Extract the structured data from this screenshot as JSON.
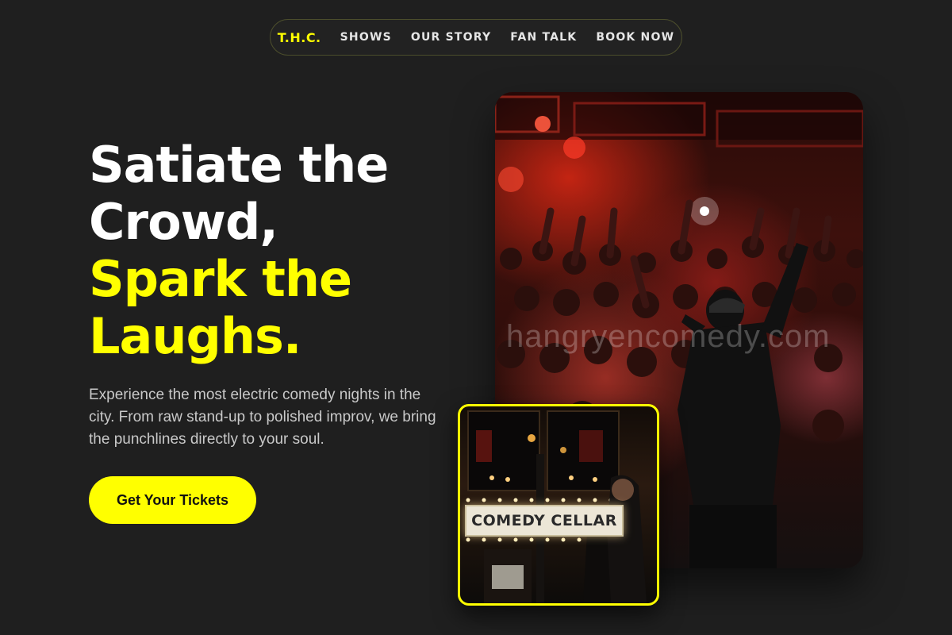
{
  "nav": {
    "brand": "T.H.C.",
    "links": [
      "SHOWS",
      "OUR STORY",
      "FAN TALK",
      "BOOK NOW"
    ]
  },
  "hero": {
    "title_lines_white": [
      "Satiate the",
      "Crowd,"
    ],
    "title_lines_yellow": [
      "Spark the",
      "Laughs."
    ],
    "description": "Experience the most electric comedy nights in the city. From raw stand-up to polished improv, we bring the punchlines directly to your soul.",
    "cta_label": "Get Your Tickets"
  },
  "images": {
    "main_alt": "Comedian performing to a cheering crowd",
    "watermark": "hangryencomedy.com",
    "small_alt": "Comedy Cellar marquee",
    "marquee_text": "COMEDY CELLAR"
  },
  "colors": {
    "background": "#1f1f1f",
    "accent": "#ffff00",
    "text": "#ffffff",
    "muted_text": "#c9c9c9"
  }
}
